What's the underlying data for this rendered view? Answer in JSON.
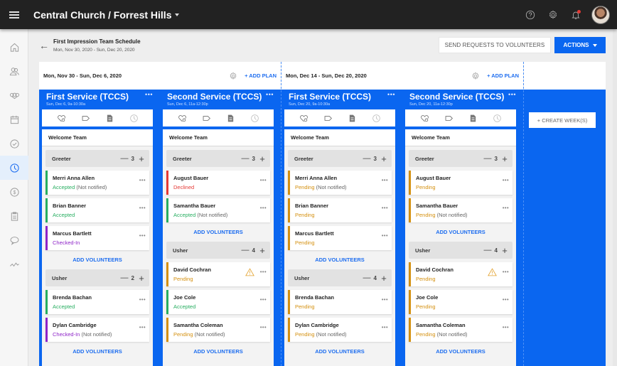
{
  "topbar": {
    "menu_icon": "hamburger-icon",
    "org_title": "Central Church / Forrest Hills",
    "icons": [
      "help-icon",
      "gear-icon",
      "bell-icon",
      "avatar"
    ]
  },
  "sidebar": {
    "items": [
      {
        "icon": "home-icon",
        "active": false
      },
      {
        "icon": "people-icon",
        "active": false
      },
      {
        "icon": "groups-icon",
        "active": false
      },
      {
        "icon": "calendar-icon",
        "active": false
      },
      {
        "icon": "check-circle-icon",
        "active": false
      },
      {
        "icon": "clock-icon",
        "active": true
      },
      {
        "icon": "dollar-icon",
        "active": false
      },
      {
        "icon": "clipboard-icon",
        "active": false
      },
      {
        "icon": "chat-icon",
        "active": false
      },
      {
        "icon": "activity-icon",
        "active": false
      }
    ]
  },
  "header": {
    "title": "First Impression Team Schedule",
    "date_range": "Mon, Nov 30, 2020 - Sun, Dec 20, 2020",
    "send_requests_label": "SEND REQUESTS TO VOLUNTEERS",
    "actions_label": "ACTIONS"
  },
  "weeks": [
    {
      "label": "Mon, Nov 30 - Sun, Dec 6, 2020",
      "add_plan": "+ ADD PLAN"
    },
    {
      "label": "Mon, Dec 14 - Sun, Dec 20, 2020",
      "add_plan": "+ ADD PLAN"
    }
  ],
  "create_week_label": "+ CREATE WEEK(S)",
  "add_volunteers_label": "ADD VOLUNTEERS",
  "plans": [
    {
      "title": "First Service (TCCS)",
      "time": "Sun, Dec 6, 9a-10:30a",
      "team": "Welcome Team",
      "roles": [
        {
          "name": "Greeter",
          "count": "3",
          "volunteers": [
            {
              "name": "Merri Anna Allen",
              "status": "Accepted",
              "note": "(Not notified)",
              "kind": "accepted",
              "warning": false
            },
            {
              "name": "Brian Banner",
              "status": "Accepted",
              "note": "",
              "kind": "accepted",
              "warning": false
            },
            {
              "name": "Marcus Bartlett",
              "status": "Checked-In",
              "note": "",
              "kind": "checkedin",
              "warning": false
            }
          ]
        },
        {
          "name": "Usher",
          "count": "2",
          "volunteers": [
            {
              "name": "Brenda Bachan",
              "status": "Accepted",
              "note": "",
              "kind": "accepted",
              "warning": false
            },
            {
              "name": "Dylan Cambridge",
              "status": "Checked-In",
              "note": "(Not notified)",
              "kind": "checkedin",
              "warning": false
            }
          ]
        }
      ]
    },
    {
      "title": "Second Service (TCCS)",
      "time": "Sun, Dec 6, 11a-12:30p",
      "team": "Welcome Team",
      "roles": [
        {
          "name": "Greeter",
          "count": "3",
          "volunteers": [
            {
              "name": "August Bauer",
              "status": "Declined",
              "note": "",
              "kind": "declined",
              "warning": false
            },
            {
              "name": "Samantha Bauer",
              "status": "Accepted",
              "note": "(Not notified)",
              "kind": "accepted",
              "warning": false
            }
          ]
        },
        {
          "name": "Usher",
          "count": "4",
          "volunteers": [
            {
              "name": "David Cochran",
              "status": "Pending",
              "note": "",
              "kind": "pending",
              "warning": true
            },
            {
              "name": "Joe Cole",
              "status": "Accepted",
              "note": "",
              "kind": "accepted",
              "warning": false
            },
            {
              "name": "Samantha Coleman",
              "status": "Pending",
              "note": "(Not notified)",
              "kind": "pending",
              "warning": false
            }
          ]
        }
      ]
    },
    {
      "title": "First Service (TCCS)",
      "time": "Sun, Dec 20, 9a-10:30a",
      "team": "Welcome Team",
      "roles": [
        {
          "name": "Greeter",
          "count": "3",
          "volunteers": [
            {
              "name": "Merri Anna Allen",
              "status": "Pending",
              "note": "(Not notified)",
              "kind": "pending",
              "warning": false
            },
            {
              "name": "Brian Banner",
              "status": "Pending",
              "note": "",
              "kind": "pending",
              "warning": false
            },
            {
              "name": "Marcus Bartlett",
              "status": "Pending",
              "note": "",
              "kind": "pending",
              "warning": false
            }
          ]
        },
        {
          "name": "Usher",
          "count": "4",
          "volunteers": [
            {
              "name": "Brenda Bachan",
              "status": "Pending",
              "note": "",
              "kind": "pending",
              "warning": false
            },
            {
              "name": "Dylan Cambridge",
              "status": "Pending",
              "note": "(Not notified)",
              "kind": "pending",
              "warning": false
            }
          ]
        }
      ]
    },
    {
      "title": "Second Service (TCCS)",
      "time": "Sun, Dec 20, 11a-12:30p",
      "team": "Welcome Team",
      "roles": [
        {
          "name": "Greeter",
          "count": "3",
          "volunteers": [
            {
              "name": "August Bauer",
              "status": "Pending",
              "note": "",
              "kind": "pending",
              "warning": false
            },
            {
              "name": "Samantha Bauer",
              "status": "Pending",
              "note": "(Not notified)",
              "kind": "pending",
              "warning": false
            }
          ]
        },
        {
          "name": "Usher",
          "count": "4",
          "volunteers": [
            {
              "name": "David Cochran",
              "status": "Pending",
              "note": "",
              "kind": "pending",
              "warning": true
            },
            {
              "name": "Joe Cole",
              "status": "Pending",
              "note": "",
              "kind": "pending",
              "warning": false
            },
            {
              "name": "Samantha Coleman",
              "status": "Pending",
              "note": "(Not notified)",
              "kind": "pending",
              "warning": false
            }
          ]
        }
      ]
    }
  ],
  "colors": {
    "brand_blue": "#0a66f0",
    "topbar": "#222222",
    "accepted": "#27ae60",
    "declined": "#e53935",
    "pending": "#d4900f",
    "checked_in": "#8e24c8",
    "warning": "#e3a12c"
  }
}
